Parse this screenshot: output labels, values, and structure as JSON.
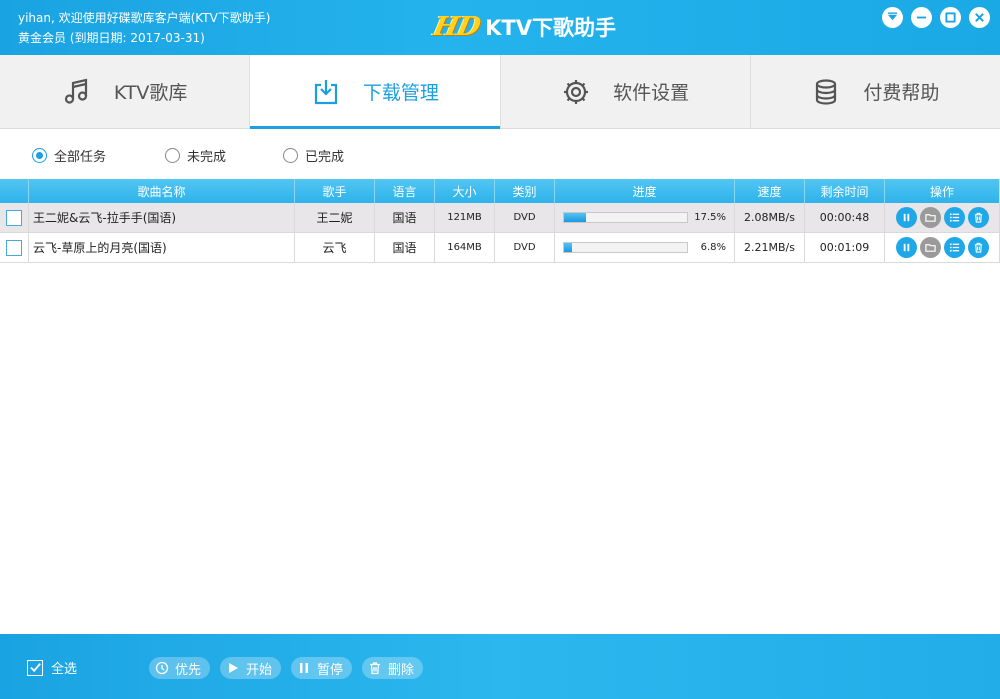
{
  "user": {
    "line1": "yihan, 欢迎使用好碟歌库客户端(KTV下歌助手)",
    "line2": "黄金会员 (到期日期: 2017-03-31)"
  },
  "app": {
    "logo_hd": "HD",
    "title": "KTV下歌助手"
  },
  "tabs": [
    {
      "label": "KTV歌库",
      "icon": "music-note-icon"
    },
    {
      "label": "下载管理",
      "icon": "download-icon"
    },
    {
      "label": "软件设置",
      "icon": "gear-icon"
    },
    {
      "label": "付费帮助",
      "icon": "database-icon"
    }
  ],
  "filters": [
    {
      "label": "全部任务",
      "selected": true
    },
    {
      "label": "未完成",
      "selected": false
    },
    {
      "label": "已完成",
      "selected": false
    }
  ],
  "table": {
    "headers": {
      "name": "歌曲名称",
      "singer": "歌手",
      "lang": "语言",
      "size": "大小",
      "type": "类别",
      "progress": "进度",
      "speed": "速度",
      "remain": "剩余时间",
      "ops": "操作"
    },
    "rows": [
      {
        "name": "王二妮&云飞-拉手手(国语)",
        "singer": "王二妮",
        "lang": "国语",
        "size": "121MB",
        "type": "DVD",
        "progress": 17.5,
        "progress_text": "17.5%",
        "speed": "2.08MB/s",
        "remain": "00:00:48"
      },
      {
        "name": "云飞-草原上的月亮(国语)",
        "singer": "云飞",
        "lang": "国语",
        "size": "164MB",
        "type": "DVD",
        "progress": 6.8,
        "progress_text": "6.8%",
        "speed": "2.21MB/s",
        "remain": "00:01:09"
      }
    ]
  },
  "bottom": {
    "select_all": "全选",
    "actions": {
      "priority": "优先",
      "start": "开始",
      "pause": "暂停",
      "delete": "删除"
    }
  },
  "colors": {
    "accent": "#1a9fe0",
    "header_blue": "#2eb3ea",
    "op_gray": "#9a9a9a"
  }
}
